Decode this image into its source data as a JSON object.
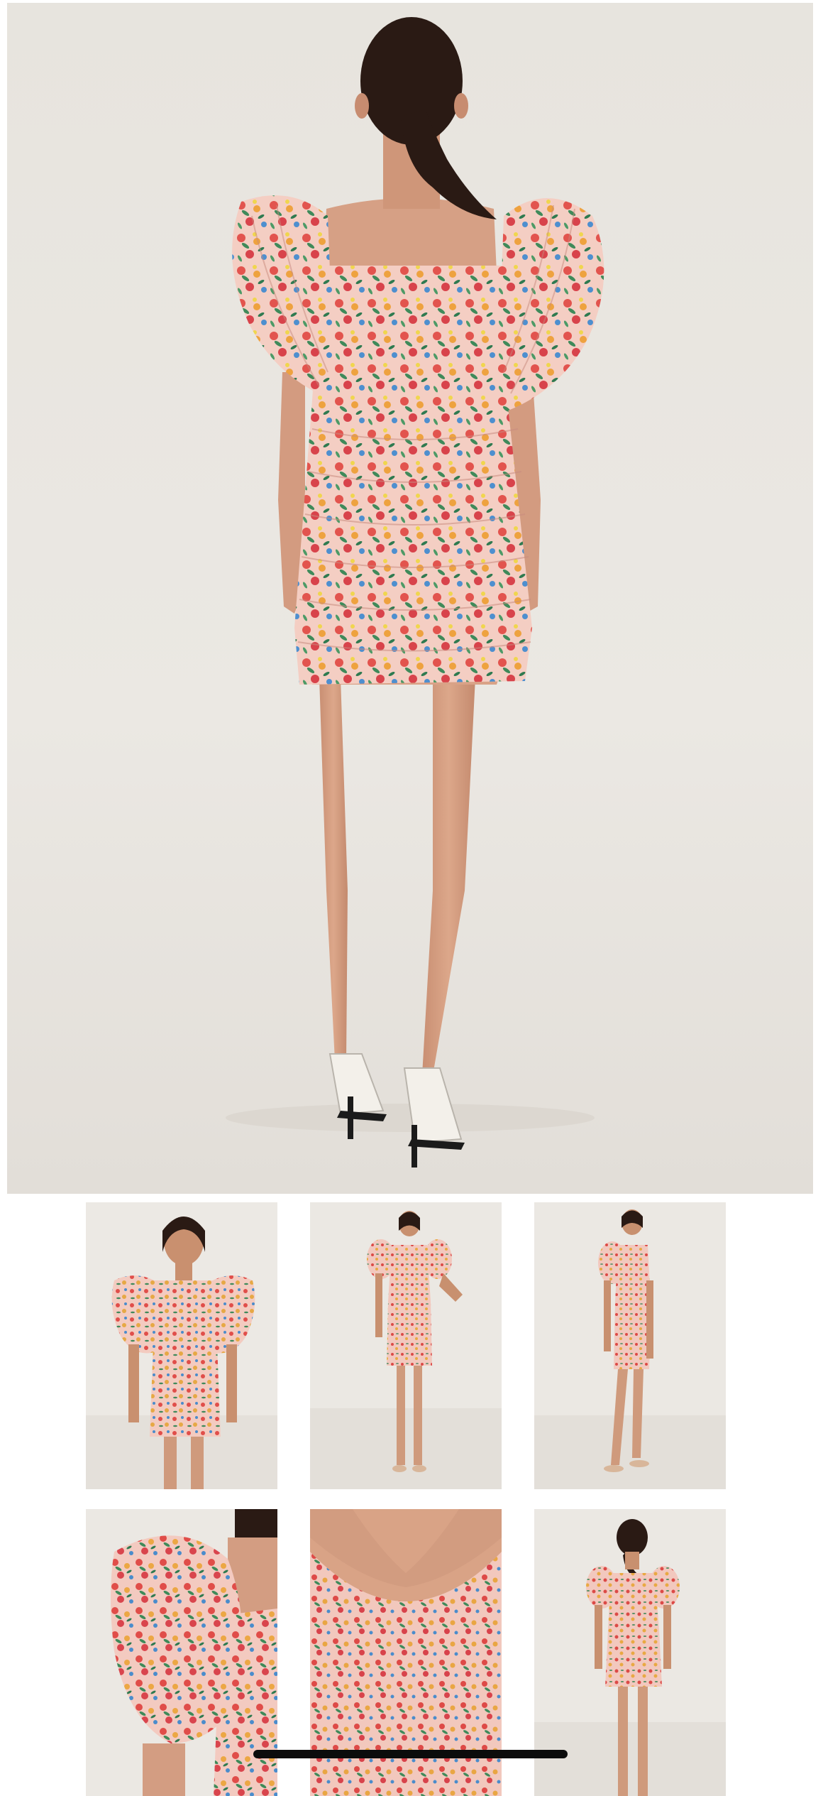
{
  "gallery": {
    "main_image": {
      "name": "floral-puff-sleeve-dress-back-view",
      "view": "back"
    },
    "thumbnails": [
      {
        "view": "front"
      },
      {
        "view": "front-full-length"
      },
      {
        "view": "side"
      },
      {
        "view": "sleeve-detail"
      },
      {
        "view": "neckline-detail"
      },
      {
        "view": "back"
      }
    ]
  },
  "colors": {
    "studio_background": "#ebe8e3",
    "floor": "#e3dfd9",
    "fabric_base": "#f3c9bf",
    "skin": "#d7a085",
    "hair": "#2a1a14",
    "shoe": "#f4f1ec"
  }
}
